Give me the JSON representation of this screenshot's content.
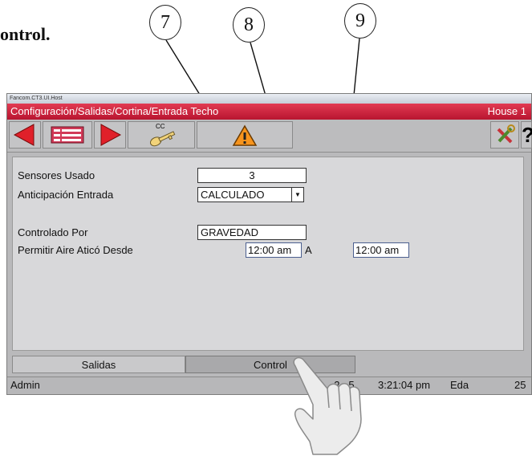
{
  "doc": {
    "heading": "ontrol.",
    "callouts": [
      "7",
      "8",
      "9"
    ]
  },
  "window": {
    "title": "Fancom.CT3.UI.Host",
    "path": "Configuración/Salidas/Cortina/Entrada Techo",
    "house": "House 1"
  },
  "toolbar": {
    "cc_label": "CC",
    "help_label": "?"
  },
  "form": {
    "sensores_label": "Sensores Usado",
    "sensores_value": "3",
    "anticipacion_label": "Anticipación Entrada",
    "anticipacion_value": "CALCULADO",
    "controlado_label": "Controlado Por",
    "controlado_value": "GRAVEDAD",
    "permitir_label": "Permitir Aire Aticó Desde",
    "time_from": "12:00 am",
    "to_label": "A",
    "time_to": "12:00 am"
  },
  "tabs": [
    {
      "label": "Salidas"
    },
    {
      "label": "Control"
    }
  ],
  "status": {
    "user": "Admin",
    "date": "1     2   5",
    "time": "3:21:04 pm",
    "eda_label": "Eda",
    "eda_value": "25"
  },
  "colors": {
    "header_red": "#d0223f",
    "nav_red": "#e0202a",
    "warning_orange": "#f7941d"
  }
}
